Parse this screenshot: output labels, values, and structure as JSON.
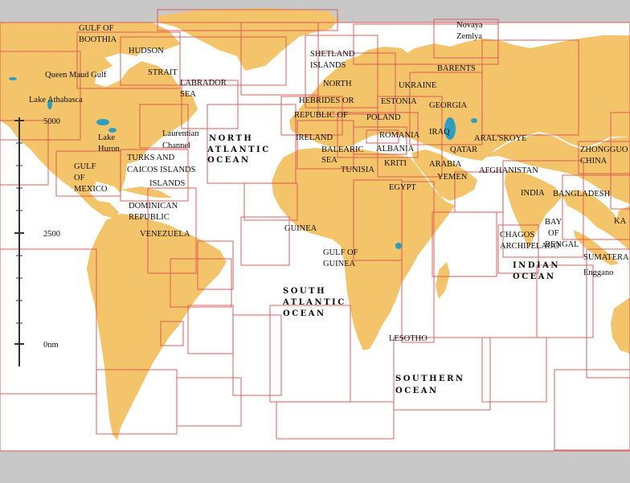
{
  "map": {
    "colors": {
      "land": "#f3c46a",
      "sea": "#ffffff",
      "chart_border": "#e05050",
      "lake": "#2e9ec0",
      "frame": "#c8c8c8"
    },
    "scale_bar": {
      "labels": [
        "5000",
        "2500",
        "0nm"
      ]
    },
    "places": {
      "gulf_of_boothia_1": "GULF OF",
      "gulf_of_boothia_2": "BOOTHIA",
      "hudson": "HUDSON",
      "strait": "STRAIT",
      "queen_maud_gulf": "Queen Maud Gulf",
      "lake_athabasca": "Lake Athabasca",
      "labrador_1": "LABRADOR",
      "labrador_2": "SEA",
      "laurentian_1": "Laurentian",
      "laurentian_2": "Channel",
      "lake_huron_1": "Lake",
      "lake_huron_2": "Huron",
      "gulf_of_mexico_1": "GULF",
      "gulf_of_mexico_2": "OF",
      "gulf_of_mexico_3": "MEXICO",
      "turks_1": "TURKS AND",
      "turks_2": "CAICOS ISLANDS",
      "islands": "ISLANDS",
      "dominican_1": "DOMINICAN",
      "dominican_2": "REPUBLIC",
      "venezuela": "VENEZUELA",
      "shetland_1": "SHETLAND",
      "shetland_2": "ISLANDS",
      "novaya_1": "Novaya",
      "novaya_2": "Zemlya",
      "barents": "BARENTS",
      "north": "NORTH",
      "hebrides": "HEBRIDES OR",
      "republic_of": "REPUBLIC OF",
      "estonia": "ESTONIA",
      "ukraine": "UKRAINE",
      "georgia": "GEORGIA",
      "poland": "POLAND",
      "romania": "ROMANIA",
      "albania": "ALBANIA",
      "iraq": "IRAQ",
      "aral": "ARAL'SKOYE",
      "qatar": "QATAR",
      "ireland": "IRELAND",
      "balearic_1": "BALEARIC",
      "balearic_2": "SEA",
      "tunisia": "TUNISIA",
      "kriti": "KRITI",
      "arabia": "ARABIA",
      "yemen": "YEMEN",
      "egypt": "EGYPT",
      "afghanistan": "AFGHANISTAN",
      "zhongguo_1": "ZHONGGUO",
      "zhongguo_2": "CHINA",
      "india": "INDIA",
      "bangladesh": "BANGLADESH",
      "bay_1": "BAY",
      "bay_2": "OF",
      "bay_3": "BENGAL",
      "chagos_1": "CHAGOS",
      "chagos_2": "ARCHIPELAGO",
      "ka": "KA",
      "sumatera": "SUMATERA",
      "enggano": "Enggano",
      "guinea": "GUINEA",
      "gulf_of_guinea_1": "GULF OF",
      "gulf_of_guinea_2": "GUINEA",
      "lesotho": "LESOTHO"
    },
    "oceans": {
      "north_atlantic_1": "NORTH",
      "north_atlantic_2": "ATLANTIC",
      "north_atlantic_3": "OCEAN",
      "south_atlantic_1": "SOUTH",
      "south_atlantic_2": "ATLANTIC",
      "south_atlantic_3": "OCEAN",
      "indian_1": "INDIAN",
      "indian_2": "OCEAN",
      "southern_1": "SOUTHERN",
      "southern_2": "OCEAN"
    }
  }
}
